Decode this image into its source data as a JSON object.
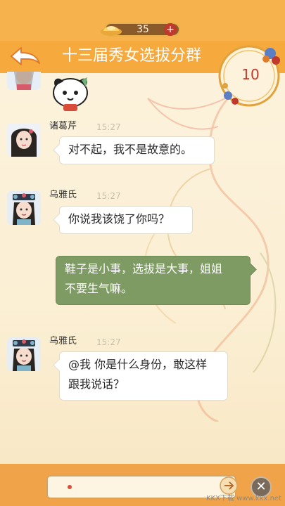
{
  "header": {
    "coins": "35",
    "plus_label": "+",
    "title": "十三届秀女选拔分群",
    "timer": "10"
  },
  "messages": [
    {
      "name": "诸葛芹",
      "time": "15:27",
      "text": "对不起，我不是故意的。"
    },
    {
      "name": "乌雅氏",
      "time": "15:27",
      "text": "你说我该饶了你吗？"
    },
    {
      "name": "",
      "time": "",
      "text_lines": [
        "鞋子是小事，选拔是大事，姐姐",
        "不要生气嘛。"
      ],
      "self": true
    },
    {
      "name": "乌雅氏",
      "time": "15:27",
      "text_lines": [
        "@我 你是什么身份，敢这样",
        "跟我说话？"
      ]
    }
  ],
  "footer": {
    "close_label": "✕"
  },
  "watermark": "KKX下载 www.kkx.net",
  "colors": {
    "header": "#f6a93d",
    "self_bubble": "#7d9b62",
    "background": "#fbf0d8"
  }
}
